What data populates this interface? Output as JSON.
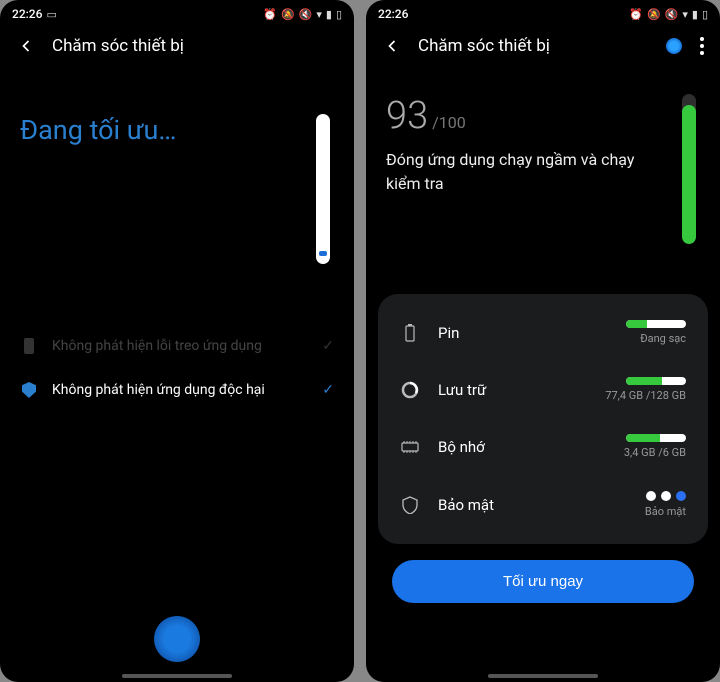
{
  "status": {
    "time": "22:26",
    "icons": [
      "alarm",
      "mute-ring",
      "mute",
      "wifi",
      "signal",
      "battery"
    ]
  },
  "left": {
    "header": {
      "title": "Chăm sóc thiết bị"
    },
    "hero": "Đang tối ưu…",
    "scan": [
      {
        "icon": "battery",
        "text": "Không phát hiện lỗi treo ứng dụng",
        "done": true,
        "dim": true
      },
      {
        "icon": "shield",
        "text": "Không phát hiện ứng dụng độc hại",
        "done": true,
        "dim": false
      }
    ]
  },
  "right": {
    "header": {
      "title": "Chăm sóc thiết bị"
    },
    "score": "93",
    "score_max": "/100",
    "score_pct": 93,
    "subtitle": "Đóng ứng dụng chạy ngầm và chạy kiểm tra",
    "rows": {
      "battery": {
        "label": "Pin",
        "pct": 35,
        "meta": "Đang sạc"
      },
      "storage": {
        "label": "Lưu trữ",
        "pct": 60,
        "meta": "77,4 GB /128 GB"
      },
      "memory": {
        "label": "Bộ nhớ",
        "pct": 57,
        "meta": "3,4 GB /6 GB"
      },
      "security": {
        "label": "Bảo mật",
        "meta": "Bảo mật"
      }
    },
    "cta": "Tối ưu ngay"
  }
}
